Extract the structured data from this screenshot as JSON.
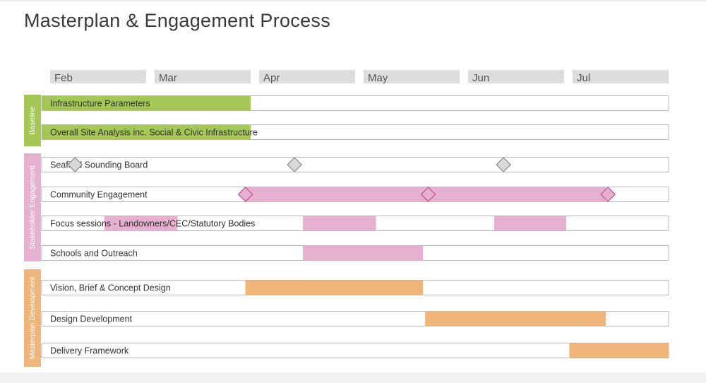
{
  "page": {
    "title": "Masterplan & Engagement Process"
  },
  "chart_data": {
    "type": "gantt",
    "title": "Masterplan & Engagement Process",
    "months": [
      "Feb",
      "Mar",
      "Apr",
      "May",
      "Jun",
      "Jul"
    ],
    "x_range_months": [
      0,
      6
    ],
    "colors": {
      "baseline": "#a4c755",
      "stakeholder": "#e6b0cf",
      "masterplan": "#f0b57a",
      "milestone_gray": "#d9d9d9",
      "milestone_pink": "#e6b0cf",
      "month_header": "#dddddd",
      "row_border": "#bbbbbb"
    },
    "groups": [
      {
        "name": "Baseline",
        "color_key": "baseline",
        "rows": [
          {
            "label": "Infrastructure Parameters",
            "bars": [
              {
                "start": 0,
                "end": 2
              }
            ],
            "milestones": [],
            "milestone_color": ""
          },
          {
            "label": "Overall Site Analysis inc. Social & Civic Infrastructure",
            "bars": [
              {
                "start": 0,
                "end": 2
              }
            ],
            "milestones": [],
            "milestone_color": ""
          }
        ]
      },
      {
        "name": "Stakeholder Engagement",
        "color_key": "stakeholder",
        "rows": [
          {
            "label": "Seafield Sounding Board",
            "bars": [],
            "milestones": [
              0.32,
              2.42,
              4.42
            ],
            "milestone_color": "milestone_gray"
          },
          {
            "label": "Community Engagement",
            "bars": [
              {
                "start": 1.95,
                "end": 5.4
              }
            ],
            "milestones": [
              1.95,
              3.7,
              5.42
            ],
            "milestone_color": "milestone_pink"
          },
          {
            "label": "Focus sessions - Landowners/CEC/Statutory Bodies",
            "bars": [
              {
                "start": 0.6,
                "end": 1.3
              },
              {
                "start": 2.5,
                "end": 3.2
              },
              {
                "start": 4.33,
                "end": 5.02
              }
            ],
            "milestones": [],
            "milestone_color": ""
          },
          {
            "label": "Schools and Outreach",
            "bars": [
              {
                "start": 2.5,
                "end": 3.65
              }
            ],
            "milestones": [],
            "milestone_color": ""
          }
        ]
      },
      {
        "name": "Masterplan Development",
        "color_key": "masterplan",
        "rows": [
          {
            "label": "Vision, Brief & Concept Design",
            "bars": [
              {
                "start": 1.95,
                "end": 3.65
              }
            ],
            "milestones": [],
            "milestone_color": ""
          },
          {
            "label": "Design Development",
            "bars": [
              {
                "start": 3.67,
                "end": 5.4
              }
            ],
            "milestones": [],
            "milestone_color": ""
          },
          {
            "label": "Delivery Framework",
            "bars": [
              {
                "start": 5.05,
                "end": 6
              }
            ],
            "milestones": [],
            "milestone_color": ""
          }
        ]
      }
    ]
  }
}
